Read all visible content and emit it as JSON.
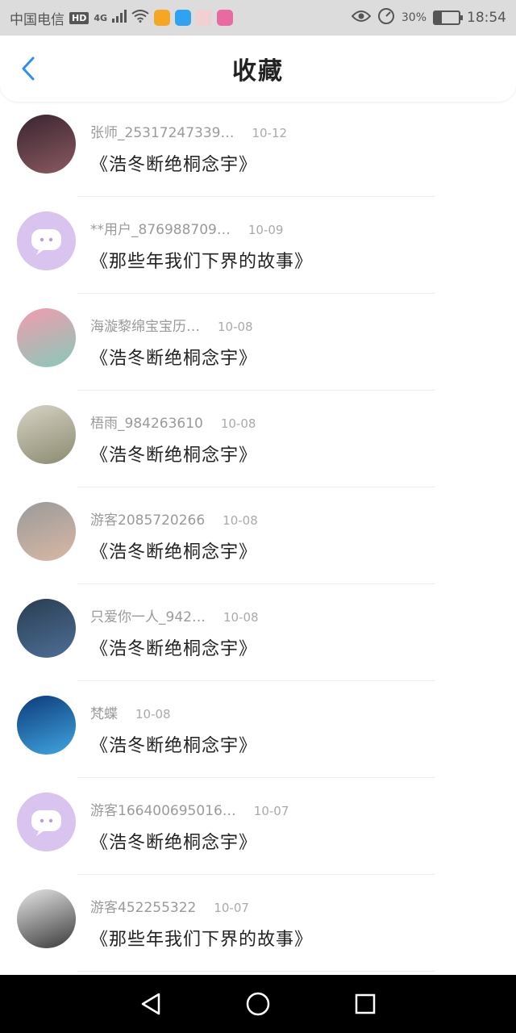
{
  "status_bar": {
    "carrier": "中国电信",
    "hd_badge": "HD",
    "network": "4G",
    "battery_percent": "30%",
    "battery_level": 0.3,
    "time": "18:54"
  },
  "header": {
    "title": "收藏"
  },
  "favorites": [
    {
      "user": "张师_25317247339…",
      "date": "10-12",
      "book": "《浩冬断绝桐念宇》",
      "avatar_colors": [
        "#3a2430",
        "#8a5a60"
      ]
    },
    {
      "user": "**用户_876988709…",
      "date": "10-09",
      "book": "《那些年我们下界的故事》",
      "avatar_colors": [
        "#d8c4ef",
        "#d8c4ef"
      ]
    },
    {
      "user": "海漩黎绵宝宝历…",
      "date": "10-08",
      "book": "《浩冬断绝桐念宇》",
      "avatar_colors": [
        "#f29cae",
        "#87c9b9"
      ]
    },
    {
      "user": "梧雨_984263610",
      "date": "10-08",
      "book": "《浩冬断绝桐念宇》",
      "avatar_colors": [
        "#d6d3c4",
        "#8b8a70"
      ]
    },
    {
      "user": "游客2085720266",
      "date": "10-08",
      "book": "《浩冬断绝桐念宇》",
      "avatar_colors": [
        "#9a9a9a",
        "#d8b8a4"
      ]
    },
    {
      "user": "只爱你一人_942…",
      "date": "10-08",
      "book": "《浩冬断绝桐念宇》",
      "avatar_colors": [
        "#2a3d52",
        "#4d6f96"
      ]
    },
    {
      "user": "梵蝶",
      "date": "10-08",
      "book": "《浩冬断绝桐念宇》",
      "avatar_colors": [
        "#0d3a7a",
        "#3fa6e0"
      ]
    },
    {
      "user": "游客166400695016…",
      "date": "10-07",
      "book": "《浩冬断绝桐念宇》",
      "avatar_colors": [
        "#d8c4ef",
        "#d8c4ef"
      ]
    },
    {
      "user": "游客452255322",
      "date": "10-07",
      "book": "《那些年我们下界的故事》",
      "avatar_colors": [
        "#e6e6e6",
        "#3a3a3a"
      ]
    }
  ]
}
